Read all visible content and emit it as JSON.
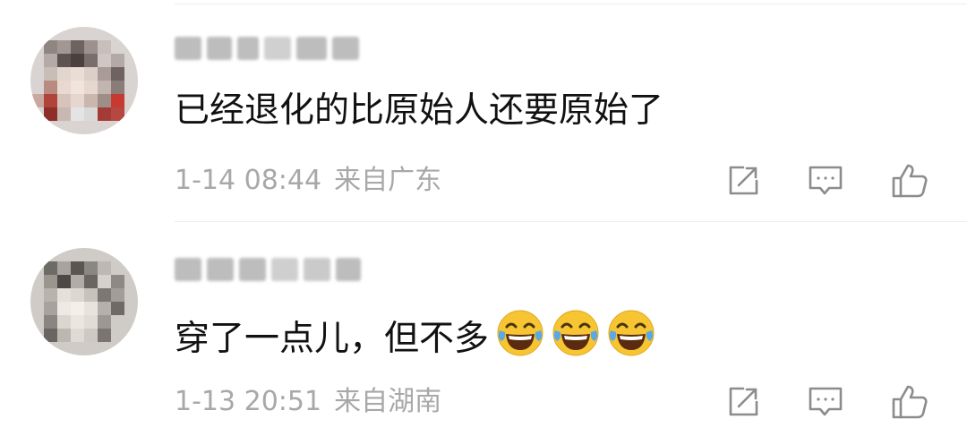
{
  "comments": [
    {
      "text": "已经退化的比原始人还要原始了",
      "time": "1-14 08:44",
      "location": "来自广东",
      "emoji_count": 0,
      "actions": [
        "share-icon",
        "comment-icon",
        "like-icon"
      ]
    },
    {
      "text": "穿了一点儿，但不多",
      "time": "1-13 20:51",
      "location": "来自湖南",
      "emoji_count": 3,
      "emoji": "laughing-crying-emoji",
      "actions": [
        "share-icon",
        "comment-icon",
        "like-icon"
      ]
    }
  ],
  "colors": {
    "text": "#111111",
    "meta": "#a8a8a8",
    "icon": "#8c8c8c",
    "divider": "#ececec",
    "emoji_face": "#f7c531",
    "emoji_tears": "#5aa9e6"
  }
}
